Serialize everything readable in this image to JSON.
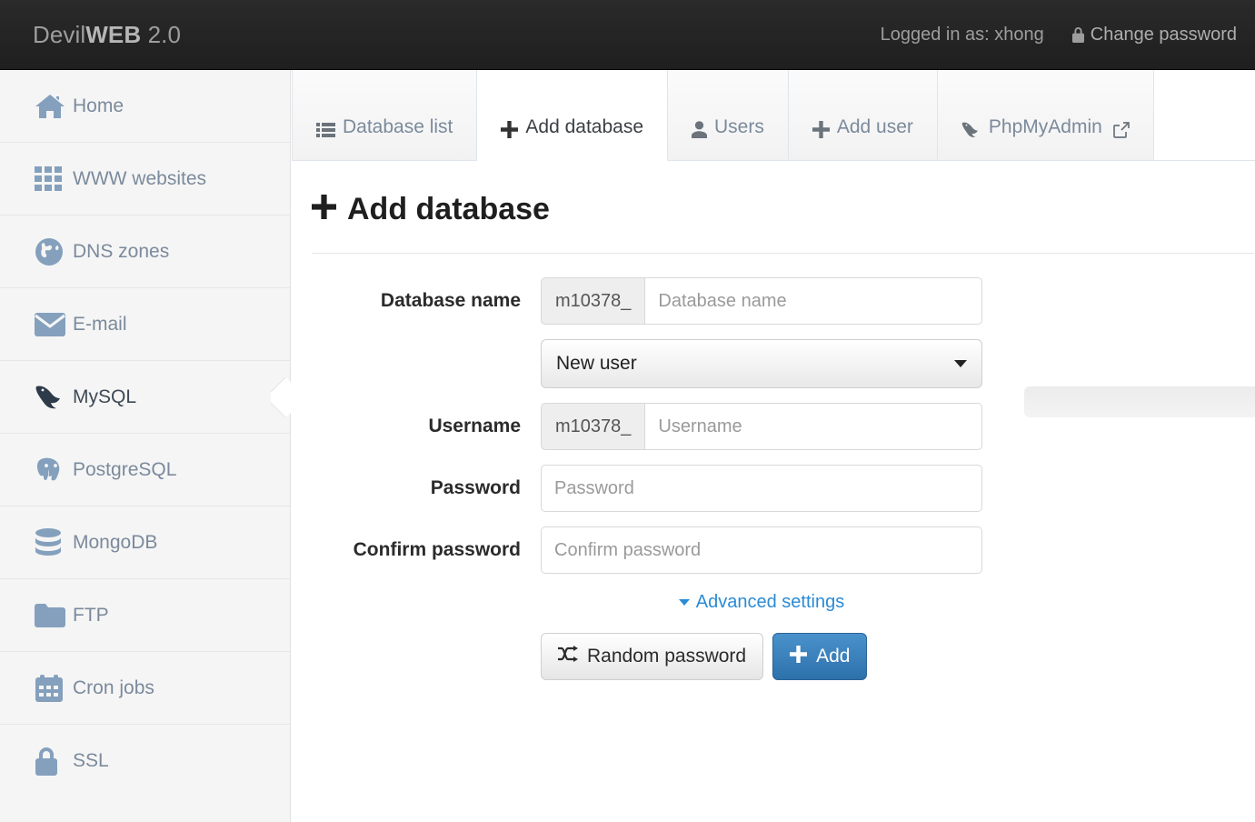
{
  "header": {
    "brand_prefix": "Devil",
    "brand_bold": "WEB",
    "brand_suffix": " 2.0",
    "logged_in": "Logged in as: xhong",
    "change_password": "Change password",
    "lock_icon": "lock-icon"
  },
  "sidebar": {
    "items": [
      {
        "label": "Home",
        "icon": "home-icon",
        "active": false
      },
      {
        "label": "WWW websites",
        "icon": "grid-icon",
        "active": false
      },
      {
        "label": "DNS zones",
        "icon": "globe-icon",
        "active": false
      },
      {
        "label": "E-mail",
        "icon": "envelope-icon",
        "active": false
      },
      {
        "label": "MySQL",
        "icon": "dolphin-icon",
        "active": true
      },
      {
        "label": "PostgreSQL",
        "icon": "elephant-icon",
        "active": false
      },
      {
        "label": "MongoDB",
        "icon": "database-icon",
        "active": false
      },
      {
        "label": "FTP",
        "icon": "folder-icon",
        "active": false
      },
      {
        "label": "Cron jobs",
        "icon": "calendar-icon",
        "active": false
      },
      {
        "label": "SSL",
        "icon": "lock-icon",
        "active": false
      }
    ]
  },
  "tabs": [
    {
      "label": "Database list",
      "icon": "list-icon",
      "active": false,
      "external": false
    },
    {
      "label": "Add database",
      "icon": "plus-icon",
      "active": true,
      "external": false
    },
    {
      "label": "Users",
      "icon": "user-icon",
      "active": false,
      "external": false
    },
    {
      "label": "Add user",
      "icon": "plus-icon",
      "active": false,
      "external": false
    },
    {
      "label": "PhpMyAdmin",
      "icon": "dolphin-icon",
      "active": false,
      "external": true
    }
  ],
  "page": {
    "title": "Add database",
    "title_icon": "plus-icon"
  },
  "form": {
    "database_name": {
      "label": "Database name",
      "prefix": "m10378_",
      "value": "",
      "placeholder": "Database name"
    },
    "user_select": {
      "selected": "New user",
      "options": [
        "New user"
      ]
    },
    "username": {
      "label": "Username",
      "prefix": "m10378_",
      "value": "",
      "placeholder": "Username"
    },
    "password": {
      "label": "Password",
      "value": "",
      "placeholder": "Password"
    },
    "confirm_password": {
      "label": "Confirm password",
      "value": "",
      "placeholder": "Confirm password"
    },
    "advanced_settings": "Advanced settings",
    "random_password_button": "Random password",
    "add_button": "Add"
  },
  "colors": {
    "header_bg": "#252525",
    "sidebar_bg": "#f5f5f5",
    "sidebar_icon": "#84a0bd",
    "link_blue": "#2b8bd4",
    "primary_button": "#3276b1"
  }
}
